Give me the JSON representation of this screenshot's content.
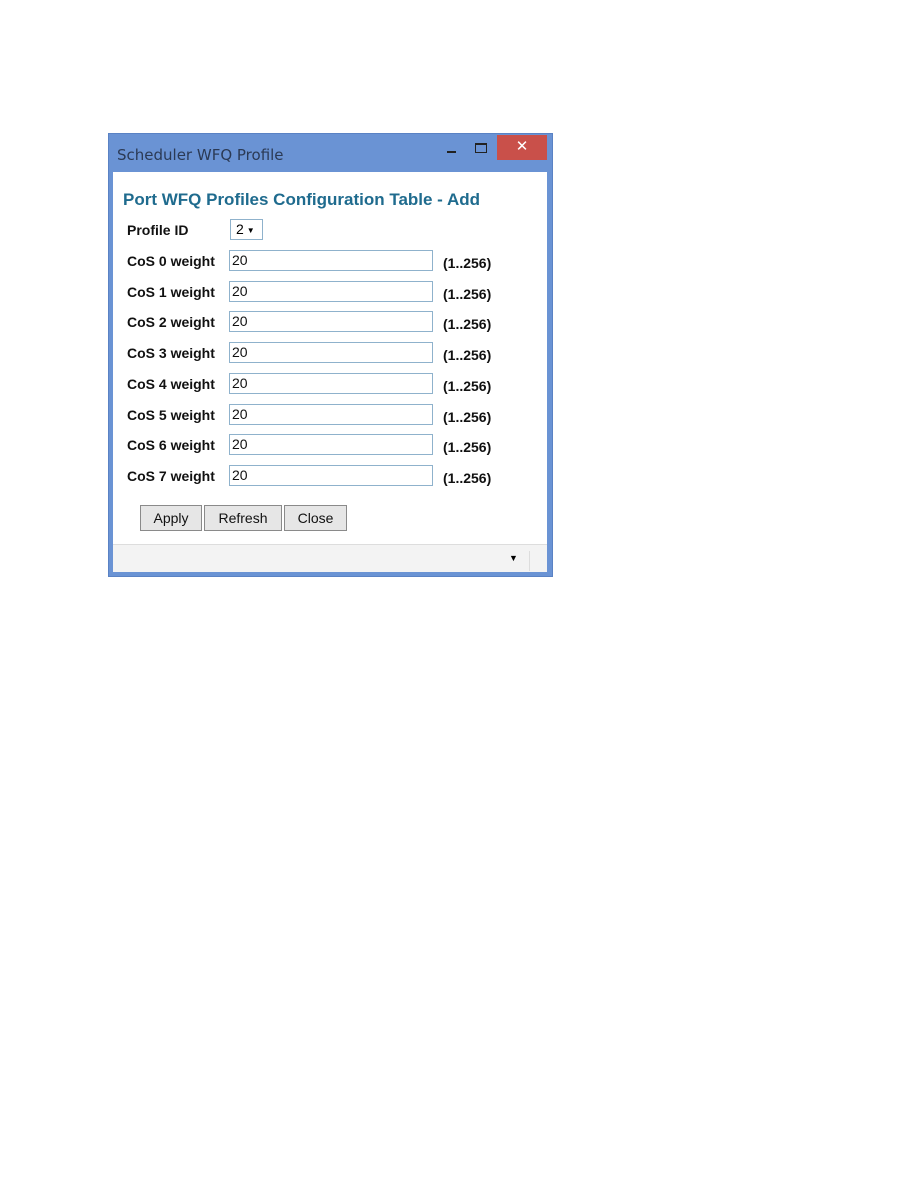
{
  "window": {
    "title": "Scheduler WFQ Profile",
    "close_glyph": "✕"
  },
  "heading": "Port WFQ Profiles Configuration Table - Add",
  "profile": {
    "label": "Profile ID",
    "value": "2",
    "arrow": "▼"
  },
  "weights": [
    {
      "label": "CoS 0 weight",
      "value": "20",
      "range": "(1..256)"
    },
    {
      "label": "CoS 1 weight",
      "value": "20",
      "range": "(1..256)"
    },
    {
      "label": "CoS 2 weight",
      "value": "20",
      "range": "(1..256)"
    },
    {
      "label": "CoS 3 weight",
      "value": "20",
      "range": "(1..256)"
    },
    {
      "label": "CoS 4 weight",
      "value": "20",
      "range": "(1..256)"
    },
    {
      "label": "CoS 5 weight",
      "value": "20",
      "range": "(1..256)"
    },
    {
      "label": "CoS 6 weight",
      "value": "20",
      "range": "(1..256)"
    },
    {
      "label": "CoS 7 weight",
      "value": "20",
      "range": "(1..256)"
    }
  ],
  "buttons": {
    "apply": "Apply",
    "refresh": "Refresh",
    "close": "Close"
  },
  "status": {
    "arrow": "▼"
  }
}
